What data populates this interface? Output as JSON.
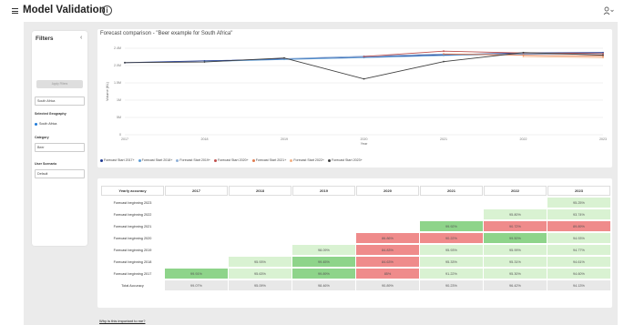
{
  "header": {
    "title": "Model Validation",
    "info_icon": "info-icon",
    "user_icon": "user-icon"
  },
  "filters": {
    "title": "Filters",
    "collapse_symbol": "‹",
    "apply_label": "Apply Filters",
    "search_value": "South Africa",
    "geography_label": "Selected Geography",
    "geography_item": "South Africa",
    "category_label": "Category",
    "category_value": "Beer",
    "scenario_label": "User Scenario",
    "scenario_value": "Default"
  },
  "chart": {
    "title": "Forecast comparison - \"Beer example for South Africa\"",
    "chart_data": {
      "type": "line",
      "title": "Forecast comparison - \"Beer example for South Africa\"",
      "xlabel": "Year",
      "ylabel": "Volume (KL)",
      "x": [
        "2017",
        "2018",
        "2019",
        "2020",
        "2021",
        "2022",
        "2023"
      ],
      "y_ticks": [
        "0",
        "5M",
        "1M",
        "1.5M",
        "2.0M",
        "2.4M"
      ],
      "ylim": [
        0,
        2.4
      ],
      "grid": true,
      "legend_position": "bottom",
      "series": [
        {
          "name": "Forecast Start 2017+",
          "color": "#1f3a93",
          "values": [
            2.0,
            2.05,
            2.1,
            2.15,
            2.22,
            2.27,
            2.28
          ]
        },
        {
          "name": "Forecast Start 2018+",
          "color": "#5b9bd5",
          "values": [
            null,
            2.03,
            2.09,
            2.14,
            2.2,
            2.24,
            2.26
          ]
        },
        {
          "name": "Forecast Start 2019+",
          "color": "#8fb0d8",
          "values": [
            null,
            null,
            2.11,
            2.18,
            2.24,
            2.23,
            2.25
          ]
        },
        {
          "name": "Forecast Start 2020+",
          "color": "#c0504d",
          "values": [
            null,
            null,
            null,
            2.17,
            2.32,
            2.27,
            2.25
          ]
        },
        {
          "name": "Forecast Start 2021+",
          "color": "#e07b4f",
          "values": [
            null,
            null,
            null,
            null,
            2.24,
            2.21,
            2.18
          ]
        },
        {
          "name": "Forecast Start 2022+",
          "color": "#f4b183",
          "values": [
            null,
            null,
            null,
            null,
            null,
            2.17,
            2.14
          ]
        },
        {
          "name": "Forecast Start 2023+",
          "color": "#404040",
          "values": [
            2.0,
            2.02,
            2.13,
            1.55,
            2.03,
            2.28,
            2.21
          ]
        }
      ]
    }
  },
  "table": {
    "header": "Yearly accuracy",
    "years": [
      "2017",
      "2018",
      "2019",
      "2020",
      "2021",
      "2022",
      "2023"
    ],
    "rows": [
      {
        "label": "Forecast beginning 2023",
        "cells": [
          "",
          "",
          "",
          "",
          "",
          "",
          "95.25%"
        ]
      },
      {
        "label": "Forecast beginning 2022",
        "cells": [
          "",
          "",
          "",
          "",
          "",
          "95.80%",
          "93.74%"
        ]
      },
      {
        "label": "Forecast beginning 2021",
        "cells": [
          "",
          "",
          "",
          "",
          "99.92%",
          "90.72%",
          "89.89%"
        ]
      },
      {
        "label": "Forecast beginning 2020",
        "cells": [
          "",
          "",
          "",
          "86.86%",
          "90.22%",
          "99.50%",
          "94.93%"
        ]
      },
      {
        "label": "Forecast beginning 2019",
        "cells": [
          "",
          "",
          "98.09%",
          "84.83%",
          "95.93%",
          "95.99%",
          "94.77%"
        ]
      },
      {
        "label": "Forecast beginning 2018",
        "cells": [
          "",
          "95.93%",
          "99.45%",
          "84.63%",
          "95.33%",
          "95.31%",
          "94.61%"
        ]
      },
      {
        "label": "Forecast beginning 2017",
        "cells": [
          "99.91%",
          "95.63%",
          "99.89%",
          "85%",
          "91.22%",
          "95.30%",
          "94.60%"
        ]
      }
    ],
    "cell_colors": [
      [
        "",
        "",
        "",
        "",
        "",
        "",
        "#d9f2d2"
      ],
      [
        "",
        "",
        "",
        "",
        "",
        "#d9f2d2",
        "#d9f2d2"
      ],
      [
        "",
        "",
        "",
        "",
        "#8ed48a",
        "#ef8b8b",
        "#ef8b8b"
      ],
      [
        "",
        "",
        "",
        "#ef8b8b",
        "#ef8b8b",
        "#8ed48a",
        "#d9f2d2"
      ],
      [
        "",
        "",
        "#d9f2d2",
        "#ef8b8b",
        "#d9f2d2",
        "#d9f2d2",
        "#d9f2d2"
      ],
      [
        "",
        "#d9f2d2",
        "#8ed48a",
        "#ef8b8b",
        "#d9f2d2",
        "#d9f2d2",
        "#d9f2d2"
      ],
      [
        "#8ed48a",
        "#d9f2d2",
        "#8ed48a",
        "#ef8b8b",
        "#d9f2d2",
        "#d9f2d2",
        "#d9f2d2"
      ]
    ],
    "total_label": "Total Accuracy",
    "totals": [
      "99.07%",
      "95.09%",
      "98.46%",
      "90.89%",
      "90.23%",
      "96.42%",
      "94.13%"
    ]
  },
  "footer": {
    "why_link": "Why is this important to me?"
  }
}
